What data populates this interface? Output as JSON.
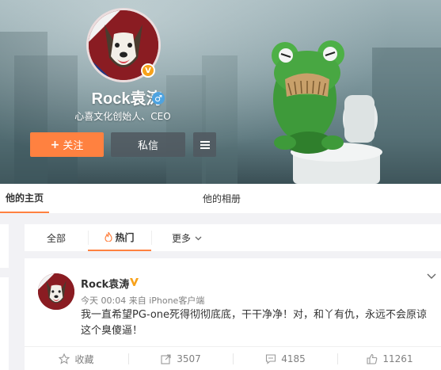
{
  "profile": {
    "name": "Rock袁涛",
    "gender_icon": "male-icon",
    "bio": "心喜文化创始人、CEO",
    "verified_badge": "V"
  },
  "buttons": {
    "follow_plus": "+",
    "follow_label": "关注",
    "message_label": "私信"
  },
  "tabs": {
    "home": "他的主页",
    "album": "他的相册"
  },
  "filter": {
    "all": "全部",
    "hot": "热门",
    "more": "更多"
  },
  "post": {
    "author": "Rock袁涛",
    "meta": "今天 00:04 来自 iPhone客户端",
    "text": "我一直希望PG-one死得彻彻底底，干干净净！对，和丫有仇，永远不会原谅这个臭傻逼！",
    "actions": {
      "favorite": "收藏",
      "repost": "3507",
      "comment": "4185",
      "like": "11261"
    }
  },
  "colors": {
    "accent": "#ff8140",
    "verified": "#f7a21b",
    "text": "#333333",
    "muted": "#808080"
  }
}
